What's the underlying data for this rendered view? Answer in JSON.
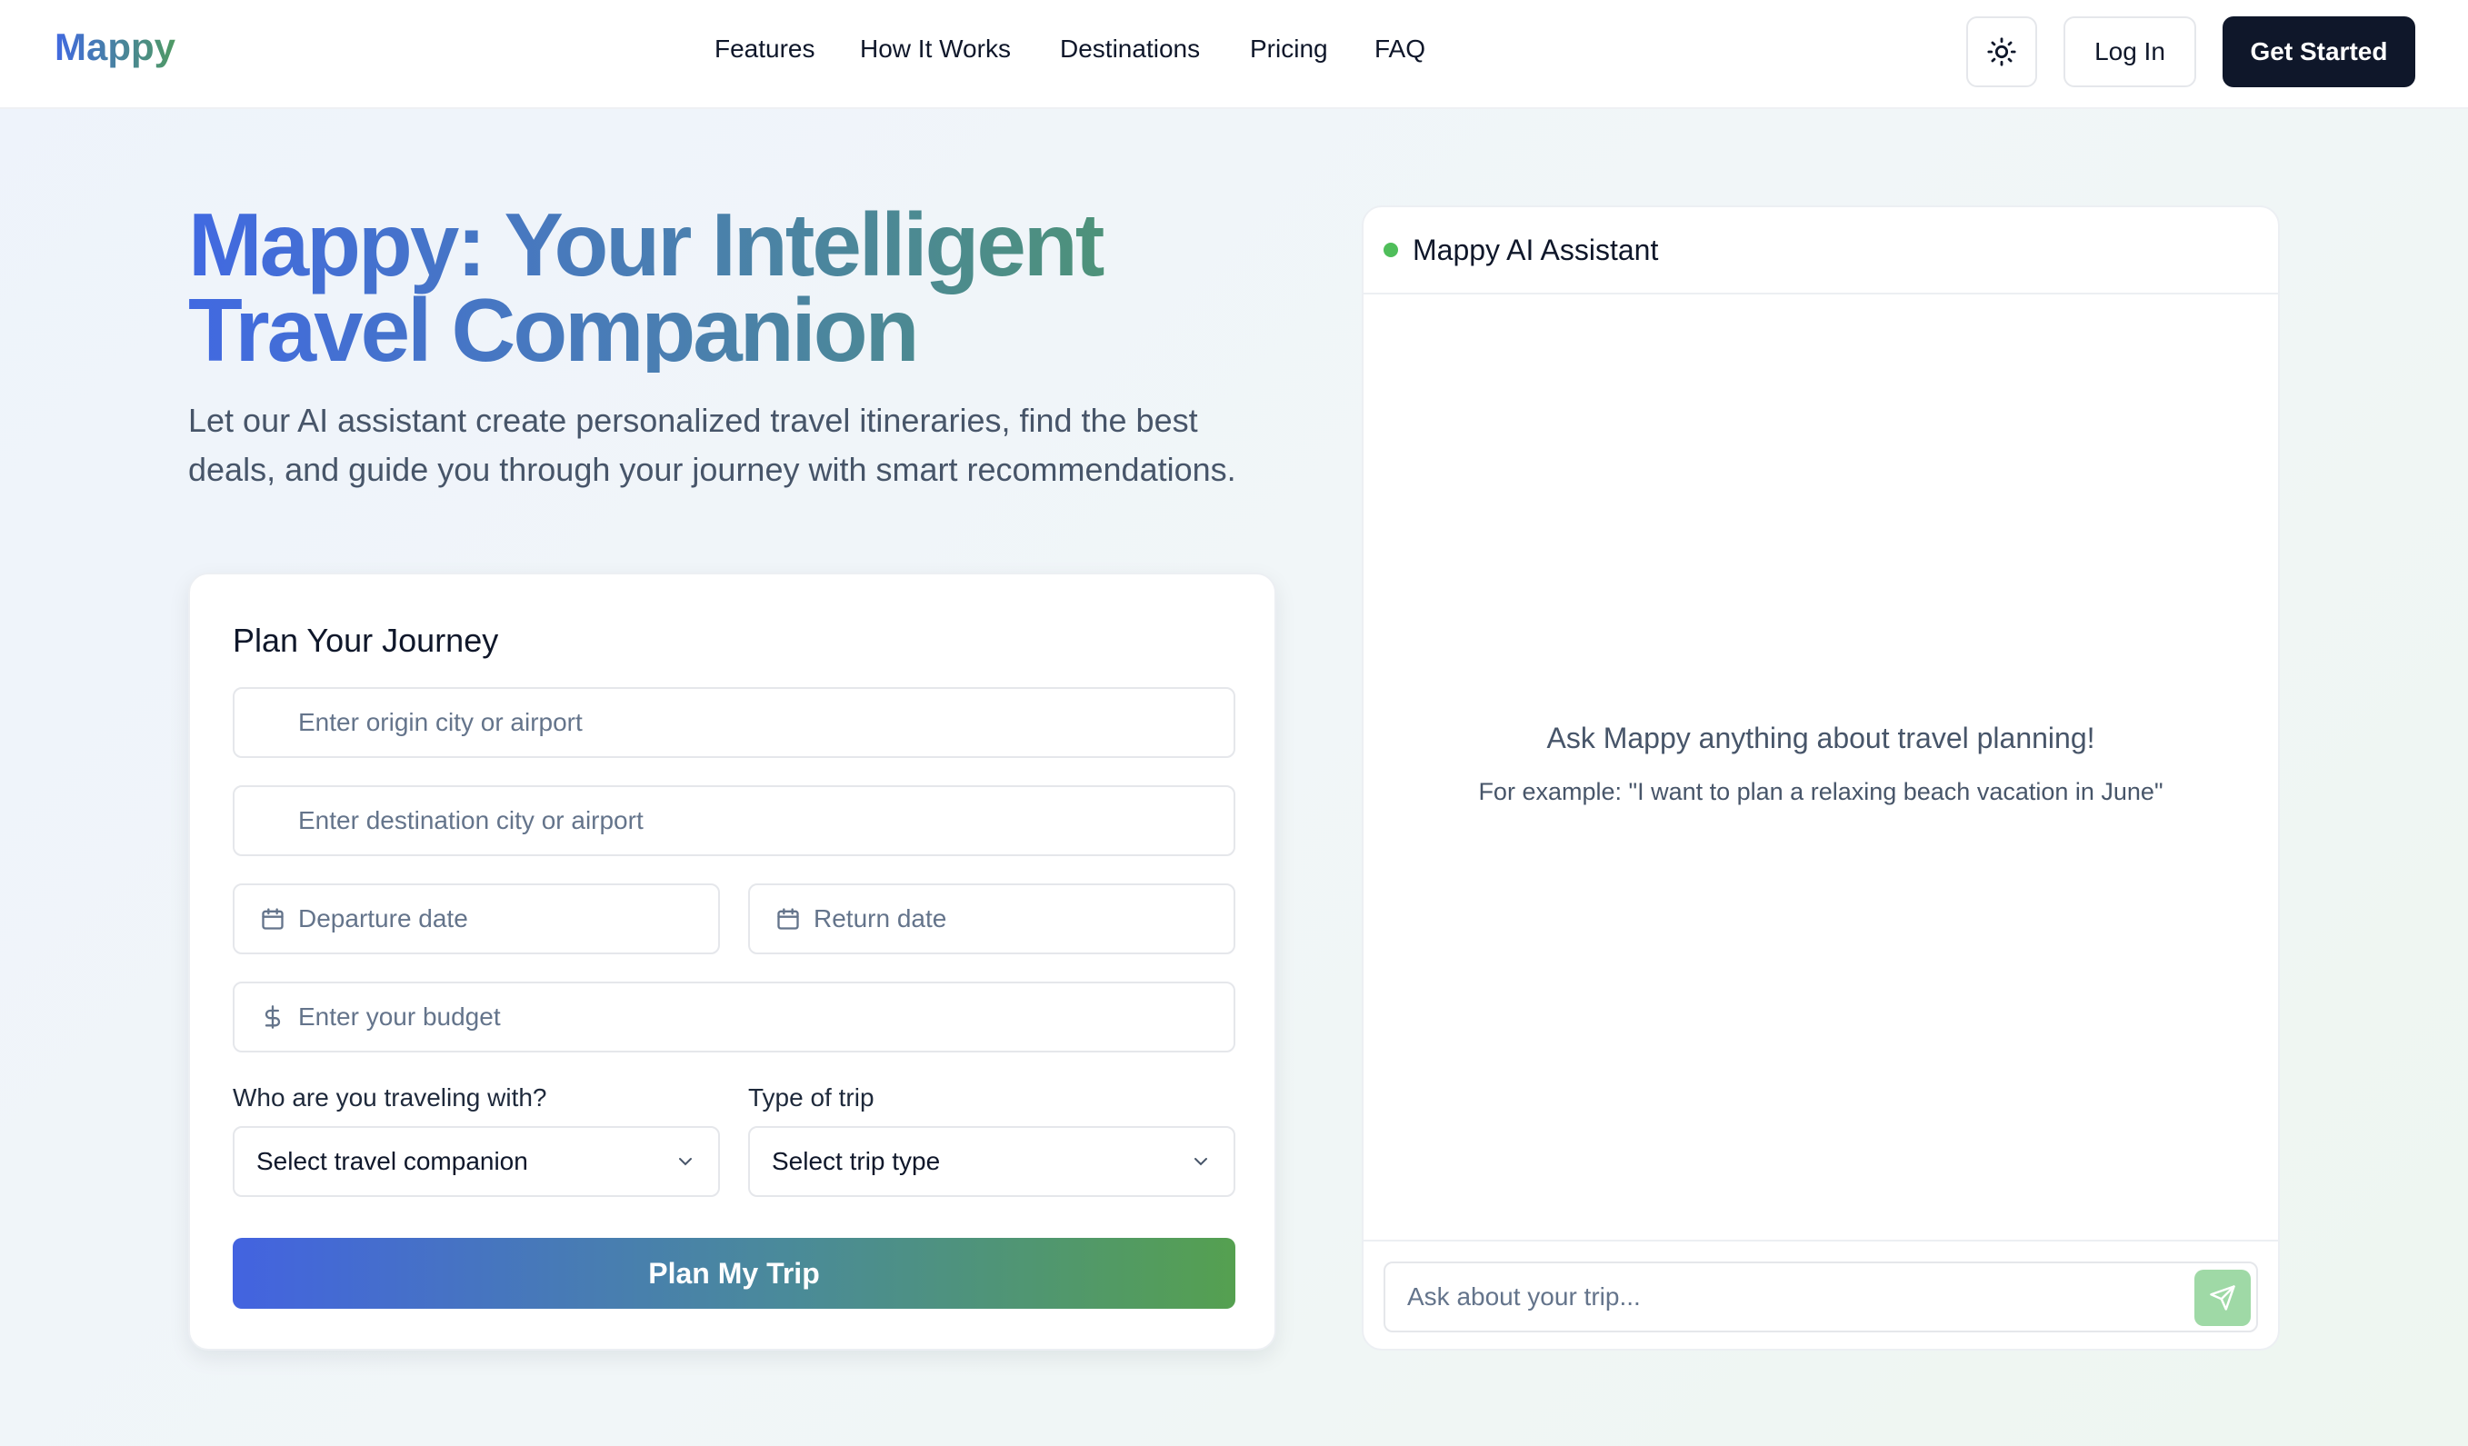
{
  "header": {
    "logo": "Mappy",
    "nav": [
      "Features",
      "How It Works",
      "Destinations",
      "Pricing",
      "FAQ"
    ],
    "theme_icon": "sun-icon",
    "login_label": "Log In",
    "cta_label": "Get Started"
  },
  "hero": {
    "title_line1": "Mappy: Your Intelligent",
    "title_line2": "Travel Companion",
    "subtitle": "Let our AI assistant create personalized travel itineraries, find the best deals, and guide you through your journey with smart recommendations."
  },
  "plan": {
    "title": "Plan Your Journey",
    "origin_placeholder": "Enter origin city or airport",
    "destination_placeholder": "Enter destination city or airport",
    "departure_placeholder": "Departure date",
    "return_placeholder": "Return date",
    "budget_placeholder": "Enter your budget",
    "companion_label": "Who are you traveling with?",
    "companion_value": "Select travel companion",
    "trip_type_label": "Type of trip",
    "trip_type_value": "Select trip type",
    "submit_label": "Plan My Trip"
  },
  "assistant": {
    "title": "Mappy AI Assistant",
    "status_color": "#4fbe5a",
    "empty_title": "Ask Mappy anything about travel planning!",
    "empty_example": "For example: \"I want to plan a relaxing beach vacation in June\"",
    "input_placeholder": "Ask about your trip...",
    "send_icon": "send-icon"
  },
  "colors": {
    "brand_blue": "#4169e1",
    "brand_green": "#4f9a63",
    "dark": "#0f172a"
  }
}
